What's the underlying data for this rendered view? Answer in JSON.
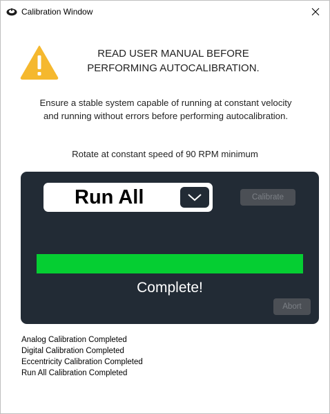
{
  "window": {
    "title": "Calibration Window",
    "close_glyph": "✕"
  },
  "warning": {
    "icon": "warning-triangle-icon",
    "line1": "READ USER MANUAL BEFORE",
    "line2": "PERFORMING AUTOCALIBRATION.",
    "icon_color": "#f5b82e"
  },
  "instructions": {
    "line1": "Ensure a stable system capable of running at constant velocity",
    "line2": "and running without errors before performing autocalibration."
  },
  "rotate_text": "Rotate at constant speed of 90 RPM minimum",
  "panel": {
    "background": "#222b35",
    "mode_select": {
      "value": "Run All",
      "icon": "chevron-down-icon"
    },
    "calibrate_label": "Calibrate",
    "progress": {
      "fraction": 1.0,
      "color": "#05ce32"
    },
    "status": "Complete!",
    "abort_label": "Abort"
  },
  "log": [
    "Analog Calibration Completed",
    "Digital Calibration Completed",
    "Eccentricity Calibration Completed",
    "Run All Calibration Completed"
  ]
}
